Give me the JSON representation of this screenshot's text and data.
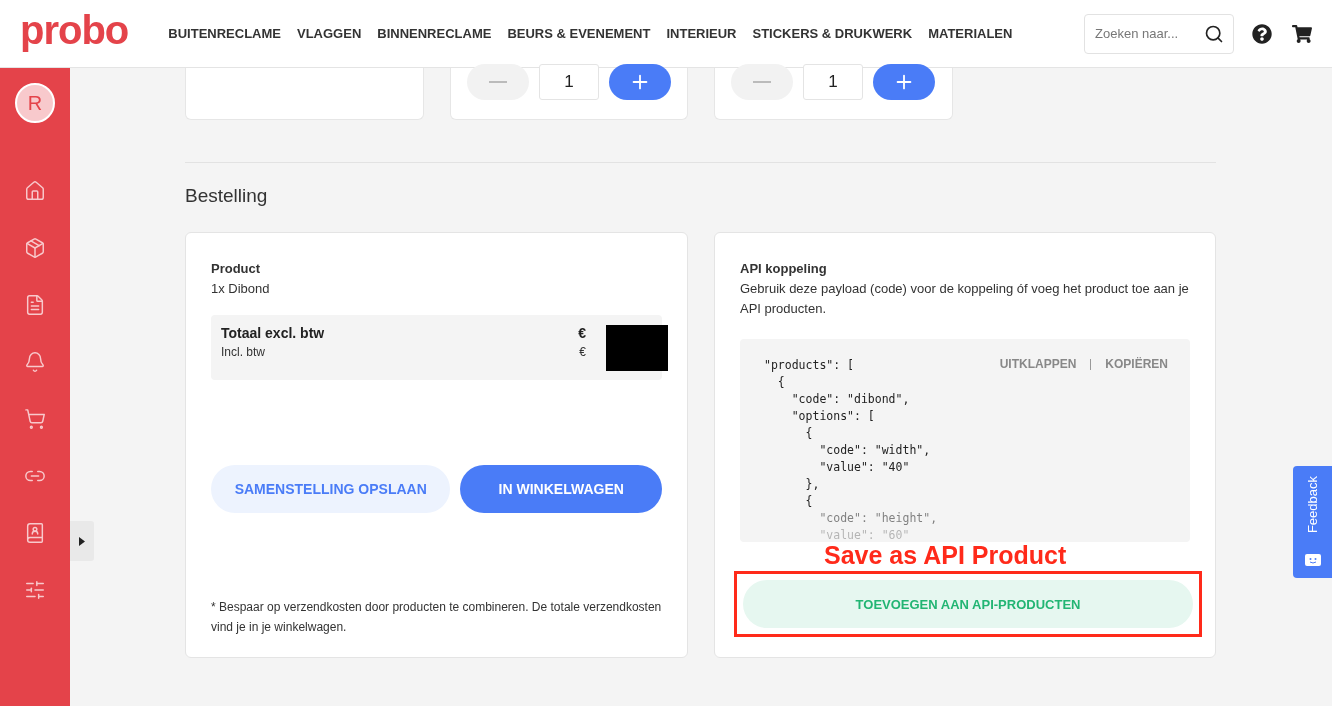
{
  "header": {
    "logo": "probo",
    "nav": [
      "BUITENRECLAME",
      "VLAGGEN",
      "BINNENRECLAME",
      "BEURS & EVENEMENT",
      "INTERIEUR",
      "STICKERS & DRUKWERK",
      "MATERIALEN"
    ],
    "search": {
      "placeholder": "Zoeken naar..."
    }
  },
  "sidebar": {
    "avatar": "R"
  },
  "top_cards": [
    {
      "kind": "blank"
    },
    {
      "kind": "stepper",
      "value": "1"
    },
    {
      "kind": "stepper",
      "value": "1"
    }
  ],
  "section_title": "Bestelling",
  "order_card": {
    "label": "Product",
    "product": "1x Dibond",
    "total_label": "Totaal excl. btw",
    "total_value": "€",
    "incl_label": "Incl. btw",
    "incl_value": "€",
    "buttons": [
      {
        "label": "SAMENSTELLING OPSLAAN",
        "kind": "secondary"
      },
      {
        "label": "IN WINKELWAGEN",
        "kind": "primary"
      }
    ],
    "footnote": "* Bespaar op verzendkosten door producten te combineren. De totale verzendkosten vind je in je winkelwagen."
  },
  "api_card": {
    "title": "API koppeling",
    "description": "Gebruik deze payload (code) voor de koppeling óf voeg het product toe aan je API producten.",
    "actions": [
      "UITKLAPPEN",
      "KOPIËREN"
    ],
    "code_lines": [
      "\"products\": [",
      "  {",
      "    \"code\": \"dibond\",",
      "    \"options\": [",
      "      {",
      "        \"code\": \"width\",",
      "        \"value\": \"40\"",
      "      },",
      "      {",
      "        \"code\": \"height\",",
      "        \"value\": \"60\""
    ],
    "button": "TOEVOEGEN AAN API-PRODUCTEN"
  },
  "annotation": {
    "text": "Save as API Product"
  },
  "feedback": {
    "label": "Feedback"
  }
}
